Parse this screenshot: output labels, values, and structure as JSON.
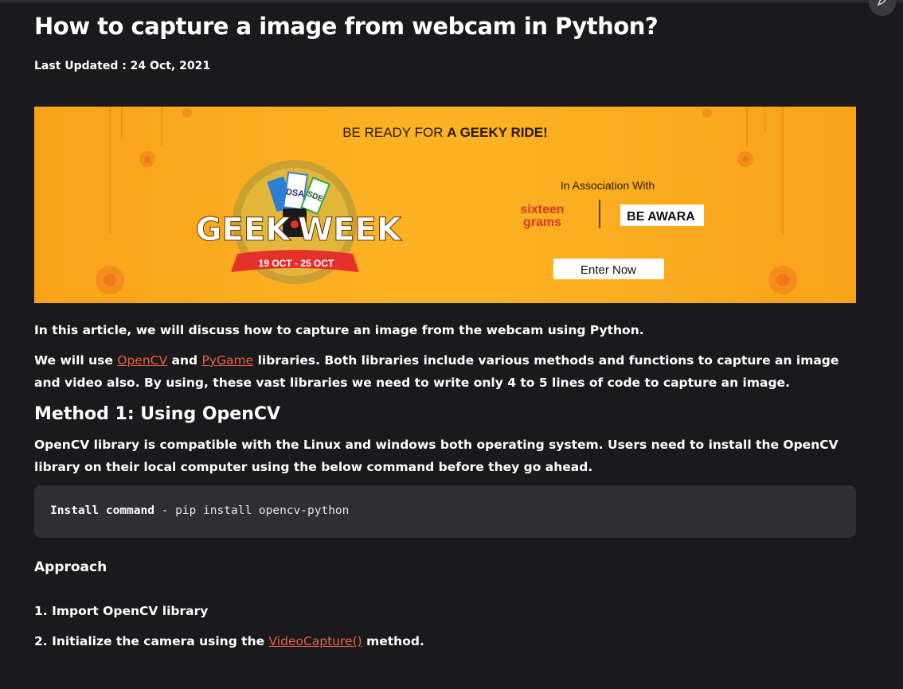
{
  "article": {
    "title": "How to capture a image from webcam in Python?",
    "last_updated": "Last Updated : 24 Oct, 2021"
  },
  "banner": {
    "headline_prefix": "BE READY FOR ",
    "headline_bold": "A GEEKY RIDE!",
    "logo_left": "GEEK",
    "logo_right": "WEEK",
    "logo_dates": "19 OCT - 25 OCT",
    "ticket_1": "DSA",
    "ticket_2": "SDE",
    "association": "In Association With",
    "sponsor_1_line_1": "sixteen",
    "sponsor_1_line_2": "grams",
    "sponsor_2": "BE AWARA",
    "cta": "Enter Now",
    "background_color": "#fbb323",
    "accent_color": "#e4312b"
  },
  "intro": "In this article, we will discuss how to capture an image from the webcam using Python.",
  "libraries_paragraph": {
    "text_1": "We will use ",
    "link_1": "OpenCV",
    "text_2": " and ",
    "link_2": "PyGame",
    "text_3": " libraries. Both libraries include various methods and functions to capture an image and video also. By using, these vast libraries we need to write only 4 to 5 lines of code to capture an image."
  },
  "method_1": {
    "heading": "Method 1: Using OpenCV",
    "description": "OpenCV library is compatible with the Linux and windows both operating system. Users need to install the OpenCV library on their local computer using the below command before they go ahead.",
    "code_label": "Install command",
    "code_text": " - pip install opencv-python"
  },
  "approach": {
    "heading": "Approach",
    "step_1": "1. Import OpenCV library",
    "step_2_prefix": "2. Initialize the camera using the ",
    "step_2_link": "VideoCapture()",
    "step_2_suffix": " method."
  },
  "colors": {
    "background": "#1a1a1d",
    "link": "#e8603c",
    "code_background": "#2e2e33"
  },
  "icons": {
    "corner": "edit-pencil-icon"
  }
}
